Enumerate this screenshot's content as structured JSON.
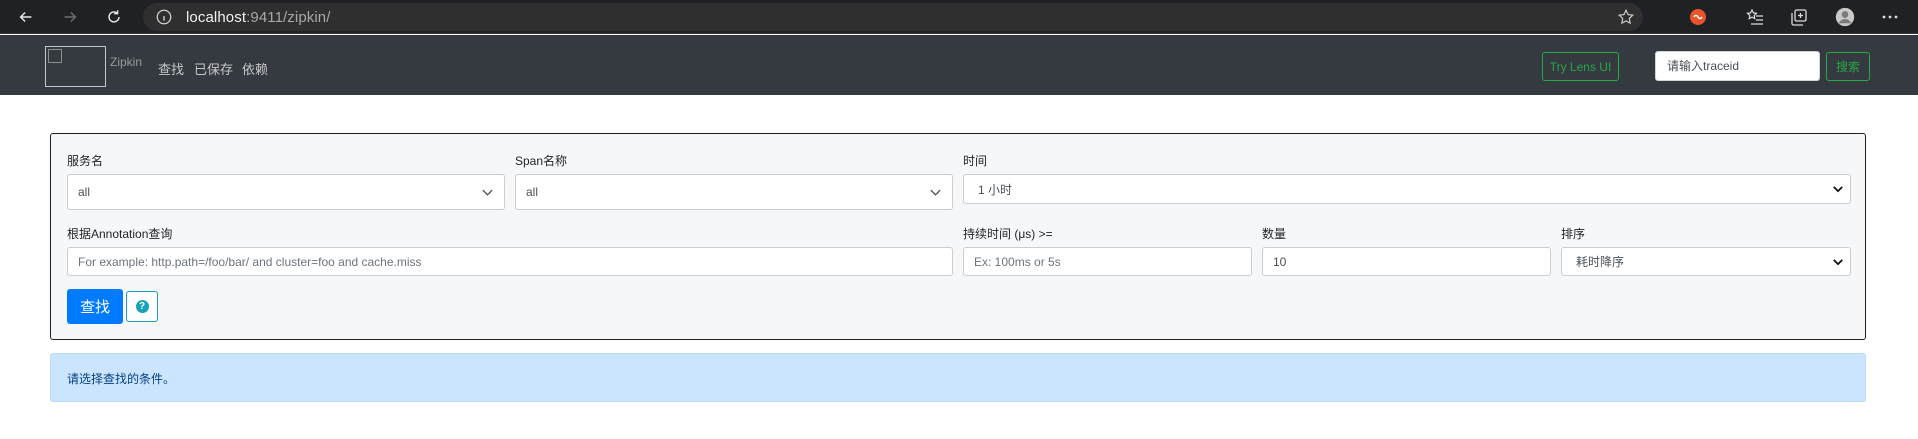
{
  "browser": {
    "url_host": "localhost",
    "url_rest": ":9411/zipkin/"
  },
  "header": {
    "brand": "Zipkin",
    "nav": [
      "查找",
      "已保存",
      "依赖"
    ],
    "lens_button": "Try Lens UI",
    "trace_placeholder": "请输入traceid",
    "search_button": "搜索"
  },
  "form": {
    "service_label": "服务名",
    "service_value": "all",
    "span_label": "Span名称",
    "span_value": "all",
    "time_label": "时间",
    "time_value": "1 小时",
    "annotation_label": "根据Annotation查询",
    "annotation_placeholder": "For example: http.path=/foo/bar/ and cluster=foo and cache.miss",
    "duration_label": "持续时间 (μs) >=",
    "duration_placeholder": "Ex: 100ms or 5s",
    "limit_label": "数量",
    "limit_value": "10",
    "sort_label": "排序",
    "sort_value": "耗时降序",
    "find_button": "查找",
    "help_glyph": "?"
  },
  "alert": {
    "message": "请选择查找的条件。"
  },
  "colors": {
    "navbar": "#343a40",
    "primary": "#007bff",
    "success": "#28a745",
    "info": "#17a2b8",
    "alert_bg": "#cce5ff"
  }
}
